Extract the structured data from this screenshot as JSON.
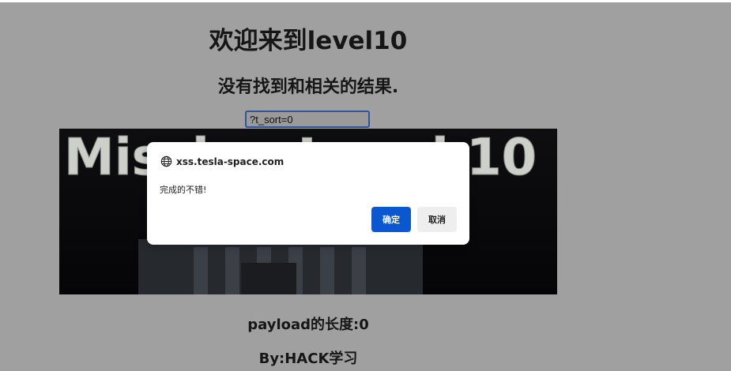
{
  "page": {
    "title": "欢迎来到level10",
    "result_text": "没有找到和相关的结果.",
    "search_value": "?t_sort=0",
    "payload_length_text": "payload的长度:0",
    "byline": "By:HACK学习"
  },
  "banner": {
    "text": "Mission Level 10",
    "icon": "mission-level-banner-image"
  },
  "dialog": {
    "origin": "xss.tesla-space.com",
    "origin_icon": "globe-icon",
    "message": "完成的不错!",
    "ok_label": "确定",
    "cancel_label": "取消"
  },
  "colors": {
    "background": "#a0a0a1",
    "ok_button": "#0b57d0",
    "cancel_button": "#eeeeee"
  }
}
